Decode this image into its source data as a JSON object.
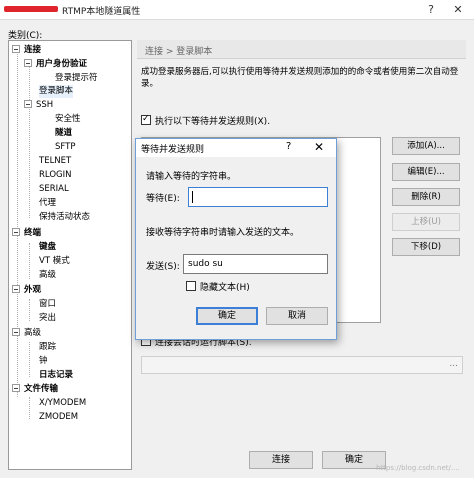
{
  "window": {
    "title": "RTMP本地隧道属性",
    "help_glyph": "?",
    "close_glyph": "✕"
  },
  "category_label": "类别(C):",
  "tree": {
    "items": [
      {
        "label": "连接",
        "bold": true
      },
      {
        "label": "用户身份验证",
        "bold": true
      },
      {
        "label": "登录提示符",
        "bold": false
      },
      {
        "label": "登录脚本",
        "bold": false
      },
      {
        "label": "SSH",
        "bold": false
      },
      {
        "label": "安全性",
        "bold": false
      },
      {
        "label": "隧道",
        "bold": true
      },
      {
        "label": "SFTP",
        "bold": false
      },
      {
        "label": "TELNET",
        "bold": false
      },
      {
        "label": "RLOGIN",
        "bold": false
      },
      {
        "label": "SERIAL",
        "bold": false
      },
      {
        "label": "代理",
        "bold": false
      },
      {
        "label": "保持活动状态",
        "bold": false
      },
      {
        "label": "终端",
        "bold": true
      },
      {
        "label": "键盘",
        "bold": true
      },
      {
        "label": "VT 模式",
        "bold": false
      },
      {
        "label": "高级",
        "bold": false
      },
      {
        "label": "外观",
        "bold": true
      },
      {
        "label": "窗口",
        "bold": false
      },
      {
        "label": "突出",
        "bold": false
      },
      {
        "label": "高级",
        "bold": false
      },
      {
        "label": "跟踪",
        "bold": false
      },
      {
        "label": "钟",
        "bold": false
      },
      {
        "label": "日志记录",
        "bold": true
      },
      {
        "label": "文件传输",
        "bold": true
      },
      {
        "label": "X/YMODEM",
        "bold": false
      },
      {
        "label": "ZMODEM",
        "bold": false
      }
    ]
  },
  "breadcrumb": "连接 > 登录脚本",
  "description": "成功登录服务器后,可以执行使用等待并发送规则添加的的命令或者使用第二次自动登录。",
  "rules_checkbox": {
    "label": "执行以下等待并发送规则(X).",
    "checked": true
  },
  "side_buttons": [
    {
      "label": "添加(A)...",
      "disabled": false
    },
    {
      "label": "编辑(E)...",
      "disabled": false
    },
    {
      "label": "删除(R)",
      "disabled": false
    },
    {
      "label": "上移(U)",
      "disabled": true
    },
    {
      "label": "下移(D)",
      "disabled": false
    }
  ],
  "run_checkbox": {
    "label": "连接会话时运行脚本(S).",
    "checked": false
  },
  "run_field": {
    "value": "",
    "ellipsis": "..."
  },
  "bottom_buttons": {
    "connect": "连接",
    "ok": "确定"
  },
  "watermark": "https://blog.csdn.net/....",
  "dialog": {
    "title": "等待并发送规则",
    "help_glyph": "?",
    "close_glyph": "✕",
    "wait_prompt": "请输入等待的字符串。",
    "wait_label": "等待(E):",
    "wait_value": "",
    "send_prompt": "接收等待字符串时请输入发送的文本。",
    "send_label": "发送(S):",
    "send_value": "sudo su",
    "hide_text": {
      "label": "隐藏文本(H)",
      "checked": false
    },
    "ok": "确定",
    "cancel": "取消"
  }
}
